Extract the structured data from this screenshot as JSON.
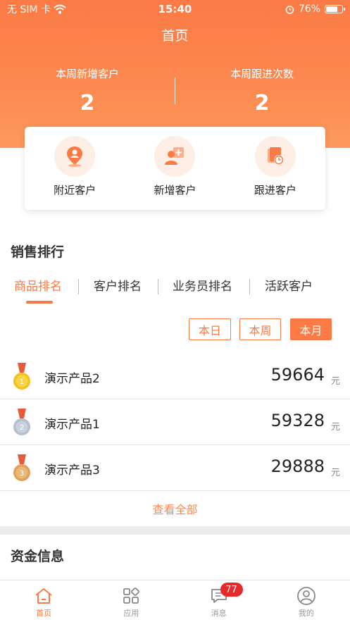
{
  "status_bar": {
    "carrier": "无 SIM 卡",
    "time": "15:40",
    "battery_text": "76%",
    "battery_level": 0.76
  },
  "header": {
    "title": "首页",
    "stats": [
      {
        "label": "本周新增客户",
        "value": "2"
      },
      {
        "label": "本周跟进次数",
        "value": "2"
      }
    ]
  },
  "quick_actions": [
    {
      "label": "附近客户",
      "icon": "location-person-icon"
    },
    {
      "label": "新增客户",
      "icon": "add-person-icon"
    },
    {
      "label": "跟进客户",
      "icon": "follow-clock-icon"
    }
  ],
  "sales_ranking": {
    "title": "销售排行",
    "tabs": [
      "商品排名",
      "客户排名",
      "业务员排名",
      "活跃客户"
    ],
    "active_tab": "商品排名",
    "ranges": [
      "本日",
      "本周",
      "本月"
    ],
    "active_range": "本月",
    "rows": [
      {
        "rank": "1",
        "name": "演示产品2",
        "amount": "59664",
        "unit": "元",
        "medal": "gold"
      },
      {
        "rank": "2",
        "name": "演示产品1",
        "amount": "59328",
        "unit": "元",
        "medal": "silver"
      },
      {
        "rank": "3",
        "name": "演示产品3",
        "amount": "29888",
        "unit": "元",
        "medal": "bronze"
      }
    ],
    "view_all": "查看全部"
  },
  "funds": {
    "title": "资金信息"
  },
  "tab_bar": {
    "items": [
      {
        "label": "首页",
        "icon": "home-icon",
        "active": true
      },
      {
        "label": "应用",
        "icon": "apps-grid-icon",
        "active": false
      },
      {
        "label": "消息",
        "icon": "message-icon",
        "active": false,
        "badge": "77"
      },
      {
        "label": "我的",
        "icon": "profile-icon",
        "active": false
      }
    ]
  },
  "colors": {
    "accent": "#fb7a45",
    "badge": "#e62a2a",
    "gold": "#f2c31a",
    "silver": "#b8bfcc",
    "bronze": "#e0a15a"
  }
}
